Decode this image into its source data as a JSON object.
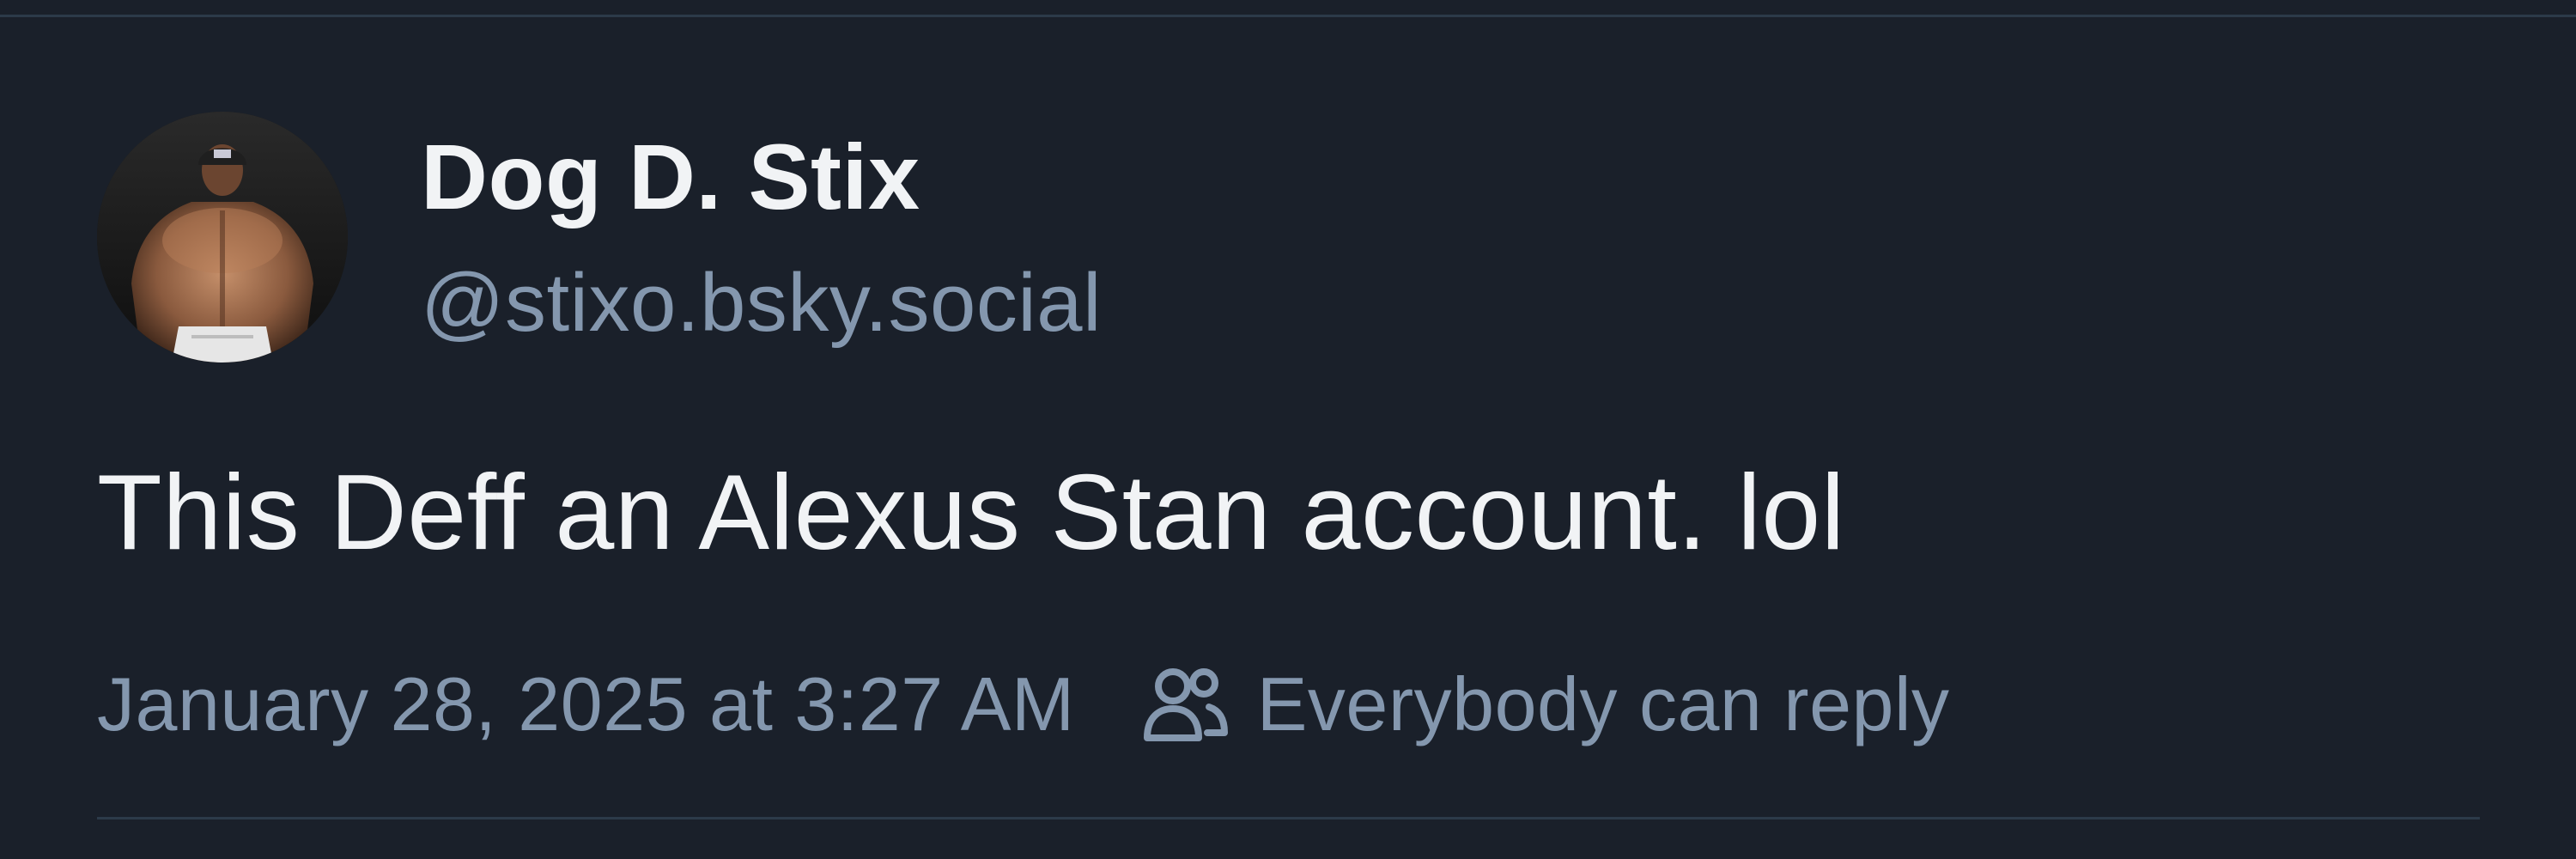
{
  "author": {
    "display_name": "Dog D. Stix",
    "handle": "@stixo.bsky.social"
  },
  "post": {
    "text": "This Deff an Alexus Stan account. lol",
    "timestamp": "January 28, 2025 at 3:27 AM",
    "reply_setting": "Everybody can reply"
  },
  "icons": {
    "reply_setting_icon": "people-icon"
  },
  "colors": {
    "background": "#1a202a",
    "primary_text": "#f1f3f5",
    "secondary_text": "#8497ae",
    "divider": "#2c3a49"
  }
}
